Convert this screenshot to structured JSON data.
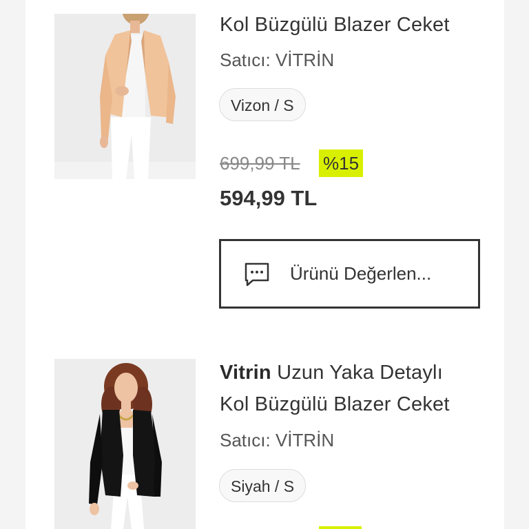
{
  "products": [
    {
      "brand": "",
      "title": "Kol Büzgülü Blazer Ceket",
      "seller_label": "Satıcı:",
      "seller_name": "VİTRİN",
      "variant": "Vizon / S",
      "old_price": "699,99 TL",
      "discount": "%15",
      "price": "594,99 TL",
      "review_label": "Ürünü Değerlen...",
      "icon": "chat-icon",
      "blazer_color": "#f1c39a"
    },
    {
      "brand": "Vitrin",
      "title_line1": "Uzun Yaka Detaylı",
      "title_line2": "Kol Büzgülü Blazer Ceket",
      "seller_label": "Satıcı:",
      "seller_name": "VİTRİN",
      "variant": "Siyah / S",
      "blazer_color": "#111111"
    }
  ],
  "colors": {
    "discount_bg": "#d8f000",
    "text": "#333333",
    "page_bg": "#f4f4f4"
  }
}
